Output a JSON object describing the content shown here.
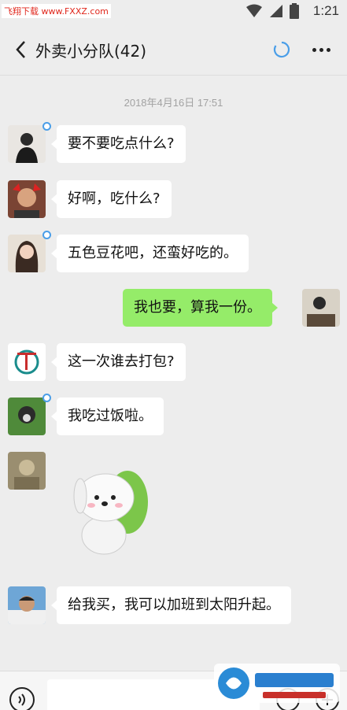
{
  "status_bar": {
    "watermark": "飞翔下载 www.FXXZ.com",
    "time": "1:21"
  },
  "header": {
    "title": "外卖小分队(42)"
  },
  "chat": {
    "timestamp": "2018年4月16日 17:51",
    "messages": [
      {
        "text": "要不要吃点什么?"
      },
      {
        "text": "好啊，吃什么?"
      },
      {
        "text": "五色豆花吧，还蛮好吃的。"
      },
      {
        "text": "我也要，算我一份。"
      },
      {
        "text": "这一次谁去打包?"
      },
      {
        "text": "我吃过饭啦。"
      },
      {
        "text": "给我买，我可以加班到太阳升起。"
      }
    ]
  },
  "colors": {
    "sent_bubble": "#95ec69",
    "received_bubble": "#ffffff",
    "accent": "#4a9ee8"
  },
  "icons": [
    "back-chevron-icon",
    "sync-icon",
    "more-icon",
    "voice-icon",
    "emoji-icon",
    "add-icon"
  ]
}
